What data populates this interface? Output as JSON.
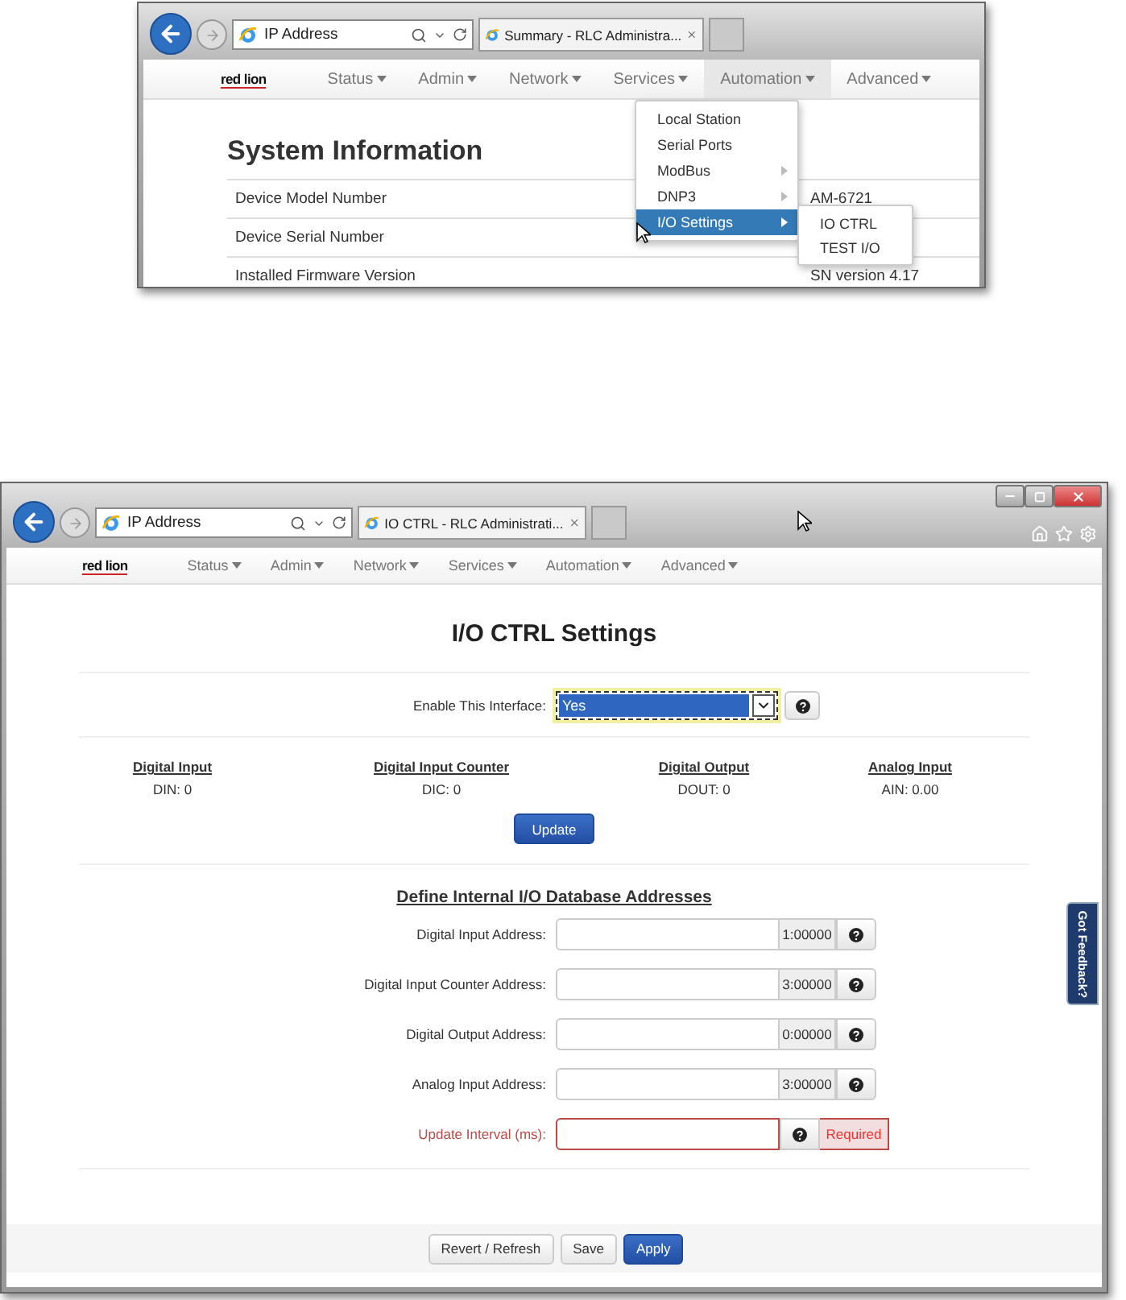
{
  "overview": {
    "browser": {
      "address": "IP Address",
      "tab_title": "Summary - RLC Administra..."
    },
    "logo": "red lion",
    "nav": [
      {
        "label": "Status",
        "selected": false
      },
      {
        "label": "Admin",
        "selected": false
      },
      {
        "label": "Network",
        "selected": false
      },
      {
        "label": "Services",
        "selected": false
      },
      {
        "label": "Automation",
        "selected": true
      },
      {
        "label": "Advanced",
        "selected": false
      }
    ],
    "heading": "System Information",
    "rows": [
      {
        "label": "Device Model Number",
        "value": "AM-6721"
      },
      {
        "label": "Device Serial Number"
      },
      {
        "label": "Installed Firmware Version",
        "value": "SN version 4.17"
      }
    ],
    "menu": [
      {
        "label": "Local Station",
        "has_submenu": false,
        "selected": false
      },
      {
        "label": "Serial Ports",
        "has_submenu": false,
        "selected": false
      },
      {
        "label": "ModBus",
        "has_submenu": true,
        "selected": false
      },
      {
        "label": "DNP3",
        "has_submenu": true,
        "selected": false
      },
      {
        "label": "I/O Settings",
        "has_submenu": true,
        "selected": true
      }
    ],
    "submenu": [
      "IO CTRL",
      "TEST I/O"
    ]
  },
  "detail": {
    "browser": {
      "address": "IP Address",
      "tab_title": "IO CTRL - RLC Administrati..."
    },
    "logo": "red lion",
    "nav": [
      {
        "label": "Status",
        "selected": false
      },
      {
        "label": "Admin",
        "selected": false
      },
      {
        "label": "Network",
        "selected": false
      },
      {
        "label": "Services",
        "selected": false
      },
      {
        "label": "Automation",
        "selected": false
      },
      {
        "label": "Advanced",
        "selected": false
      }
    ],
    "title": "I/O CTRL Settings",
    "enable": {
      "label": "Enable This Interface:",
      "value": "Yes"
    },
    "status": [
      {
        "heading": "Digital Input",
        "value": "DIN: 0"
      },
      {
        "heading": "Digital Input Counter",
        "value": "DIC: 0"
      },
      {
        "heading": "Digital Output",
        "value": "DOUT: 0"
      },
      {
        "heading": "Analog Input",
        "value": "AIN: 0.00"
      }
    ],
    "update_button": "Update",
    "section_heading": "Define Internal I/O Database Addresses",
    "fields": [
      {
        "label": "Digital Input Address:",
        "addon": "1:00000",
        "required": false
      },
      {
        "label": "Digital Input Counter Address:",
        "addon": "3:00000",
        "required": false
      },
      {
        "label": "Digital Output Address:",
        "addon": "0:00000",
        "required": false
      },
      {
        "label": "Analog Input Address:",
        "addon": "3:00000",
        "required": false
      },
      {
        "label": "Update Interval (ms):",
        "required": true,
        "error": "Required"
      }
    ],
    "buttons": [
      {
        "label": "Revert / Refresh",
        "kind": "default"
      },
      {
        "label": "Save",
        "kind": "default"
      },
      {
        "label": "Apply",
        "kind": "primary"
      }
    ],
    "feedback": "Got Feedback?"
  }
}
